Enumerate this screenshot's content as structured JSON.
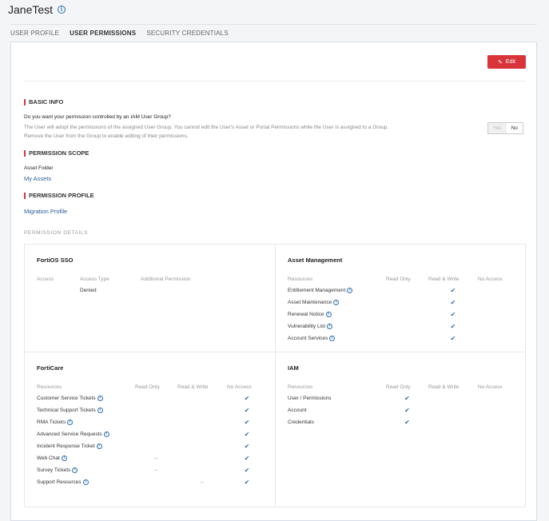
{
  "title": "JaneTest",
  "tabs": [
    "USER PROFILE",
    "USER PERMISSIONS",
    "SECURITY CREDENTIALS"
  ],
  "edit_label": "Edit",
  "basic": {
    "heading": "BASIC INFO",
    "question": "Do you want your permission controlled by an IAM User Group?",
    "desc1": "The User will adopt the permissions of the assigned User Group. You cannot edit the User's Asset or Portal Permissions while the User is assigned to a Group.",
    "desc2": "Remove the User from the Group to enable editing of their permissions.",
    "yes": "Yes",
    "no": "No"
  },
  "scope": {
    "heading": "PERMISSION SCOPE",
    "label": "Asset Folder",
    "value": "My Assets"
  },
  "profile": {
    "heading": "PERMISSION PROFILE",
    "value": "Migration Profile"
  },
  "details_label": "PERMISSION DETAILS",
  "fortios": {
    "title": "FortiOS SSO",
    "headers": [
      "Access",
      "Access Type",
      "Additional Permission"
    ],
    "values": [
      "",
      "Denied",
      ""
    ]
  },
  "cols": [
    "Resources",
    "Read Only",
    "Read & Write",
    "No Access"
  ],
  "check": "✔",
  "dash": "--",
  "asset": {
    "title": "Asset Management",
    "rows": [
      {
        "name": "Entitlement Management",
        "info": true,
        "v": [
          "",
          "✔",
          ""
        ]
      },
      {
        "name": "Asset Maintenance",
        "info": true,
        "v": [
          "",
          "✔",
          ""
        ]
      },
      {
        "name": "Renewal Notice",
        "info": true,
        "v": [
          "",
          "✔",
          ""
        ]
      },
      {
        "name": "Vulnerability List",
        "info": true,
        "v": [
          "",
          "✔",
          ""
        ]
      },
      {
        "name": "Account Services",
        "info": true,
        "v": [
          "",
          "✔",
          ""
        ]
      }
    ]
  },
  "forticare": {
    "title": "FortiCare",
    "rows": [
      {
        "name": "Customer Service Tickets",
        "info": true,
        "v": [
          "",
          "",
          "✔"
        ]
      },
      {
        "name": "Technical Support Tickets",
        "info": true,
        "v": [
          "",
          "",
          "✔"
        ]
      },
      {
        "name": "RMA Tickets",
        "info": true,
        "v": [
          "",
          "",
          "✔"
        ]
      },
      {
        "name": "Advanced Service Requests",
        "info": true,
        "v": [
          "",
          "",
          "✔"
        ]
      },
      {
        "name": "Incident Response Ticket",
        "info": true,
        "v": [
          "",
          "",
          "✔"
        ]
      },
      {
        "name": "Web Chat",
        "info": true,
        "v": [
          "--",
          "",
          "✔"
        ]
      },
      {
        "name": "Survey Tickets",
        "info": true,
        "v": [
          "--",
          "",
          "✔"
        ]
      },
      {
        "name": "Support Resources",
        "info": true,
        "v": [
          "",
          "--",
          "✔"
        ]
      }
    ]
  },
  "iam": {
    "title": "IAM",
    "rows": [
      {
        "name": "User / Permissions",
        "info": false,
        "v": [
          "✔",
          "",
          ""
        ]
      },
      {
        "name": "Account",
        "info": false,
        "v": [
          "✔",
          "",
          ""
        ]
      },
      {
        "name": "Credentials",
        "info": false,
        "v": [
          "✔",
          "",
          ""
        ]
      }
    ]
  }
}
